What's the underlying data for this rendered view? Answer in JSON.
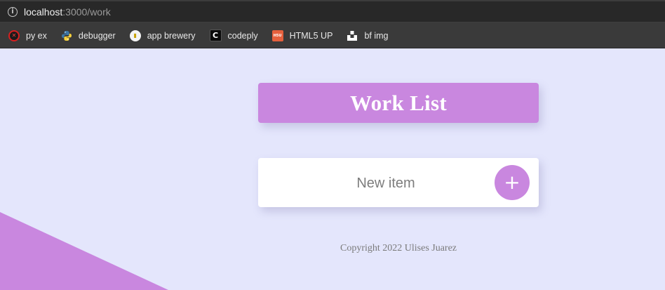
{
  "browser": {
    "url_host": "localhost",
    "url_path": ":3000/work",
    "bookmarks": [
      {
        "label": "py ex",
        "icon": "python-exercise-icon"
      },
      {
        "label": "debugger",
        "icon": "python-logo-icon"
      },
      {
        "label": "app brewery",
        "icon": "app-brewery-icon"
      },
      {
        "label": "codeply",
        "icon": "codeply-icon",
        "glyph": "C"
      },
      {
        "label": "HTML5 UP",
        "icon": "html5-up-icon",
        "glyph": "H5U"
      },
      {
        "label": "bf img",
        "icon": "bf-img-icon"
      }
    ]
  },
  "heading": {
    "title": "Work List"
  },
  "form": {
    "input_placeholder": "New item",
    "input_value": "",
    "add_button_label": "+"
  },
  "footer": {
    "copyright": "Copyright 2022 Ulises Juarez"
  },
  "colors": {
    "page_background": "#E4E6FC",
    "accent": "#C987DF",
    "card_background": "#FFFFFF",
    "footer_text": "#7A7A7A"
  }
}
